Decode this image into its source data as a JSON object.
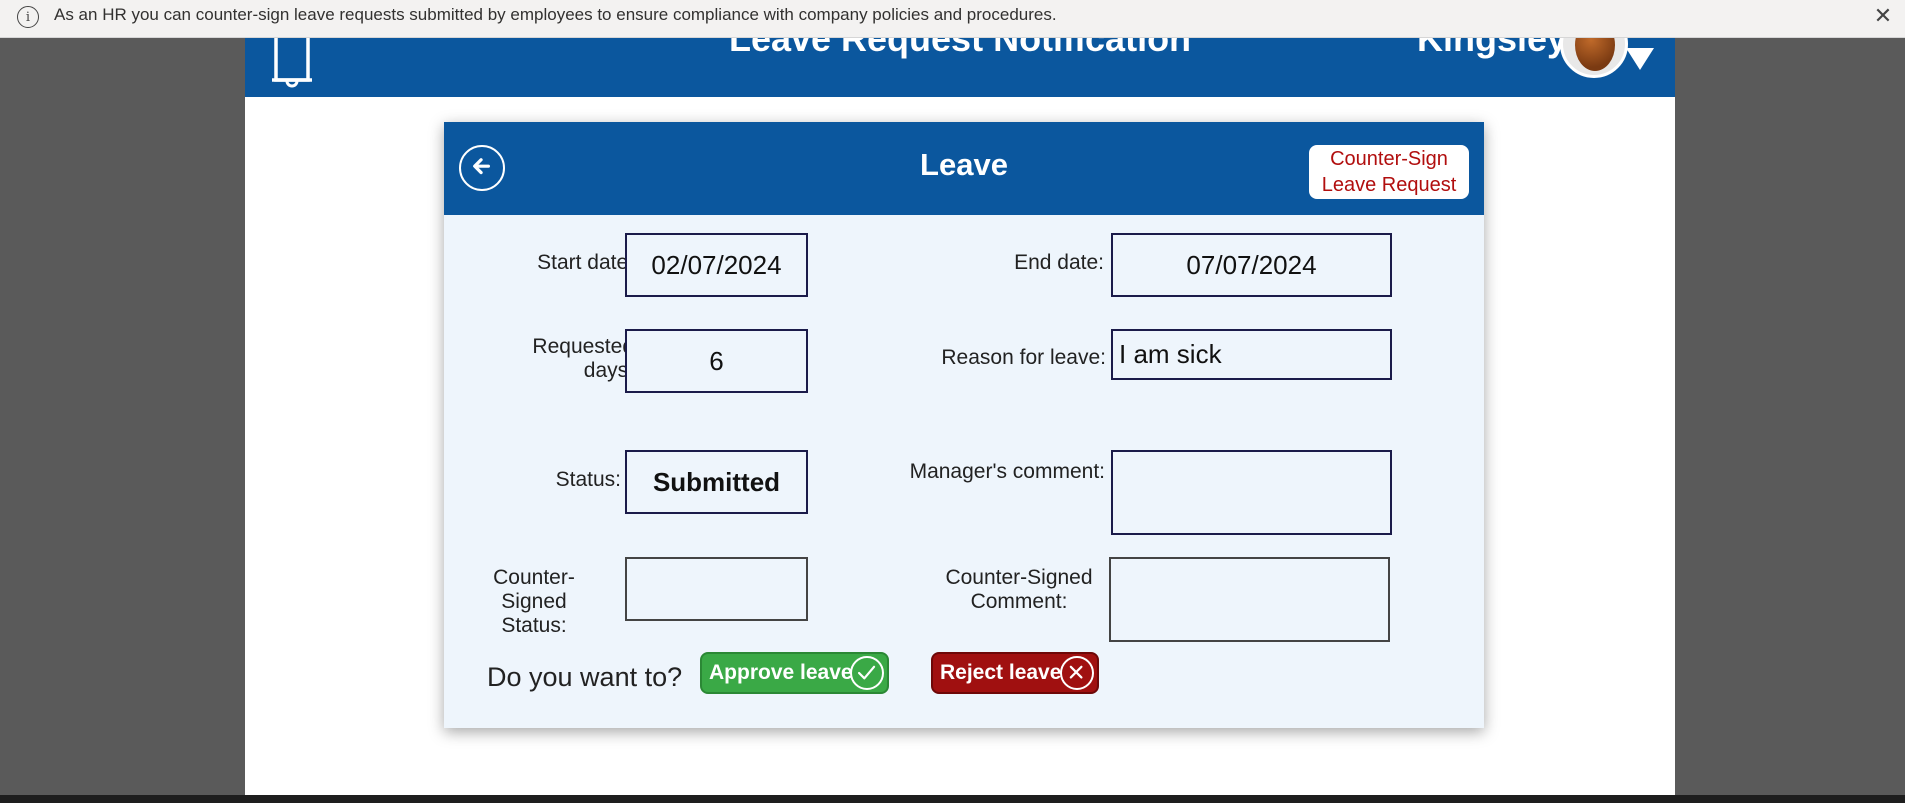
{
  "infobar": {
    "message": "As an HR you can counter-sign leave requests submitted by employees to ensure compliance with company policies and procedures.",
    "info_icon": "info-icon",
    "close_icon": "close-icon",
    "close_glyph": "✕",
    "info_glyph": "i"
  },
  "header": {
    "title": "Leave Request Notification",
    "user_name": "Kingsley",
    "bell_icon": "bell-icon",
    "avatar_icon": "avatar",
    "dropdown_icon": "chevron-down-icon"
  },
  "card": {
    "title": "Leave",
    "back_icon": "back-arrow-icon",
    "countersign_line1": "Counter-Sign",
    "countersign_line2": "Leave Request"
  },
  "form": {
    "start_date_label": "Start date:",
    "start_date_value": "02/07/2024",
    "end_date_label": "End date:",
    "end_date_value": "07/07/2024",
    "requested_days_label_line1": "Requested",
    "requested_days_label_line2": "days:",
    "requested_days_value": "6",
    "reason_label": "Reason for leave:",
    "reason_value": "I am sick",
    "status_label": "Status:",
    "status_value": "Submitted",
    "manager_comment_label": "Manager's comment:",
    "manager_comment_value": "",
    "cs_status_label_line1": "Counter-Signed",
    "cs_status_label_line2": "Status:",
    "cs_status_value": "",
    "cs_comment_label_line1": "Counter-Signed",
    "cs_comment_label_line2": "Comment:",
    "cs_comment_value": ""
  },
  "actions": {
    "prompt": "Do you want to?",
    "approve_label": "Approve leave",
    "approve_icon": "checkmark-icon",
    "reject_label": "Reject leave",
    "reject_icon": "x-circle-icon"
  },
  "colors": {
    "header_blue": "#0b579e",
    "card_bg": "#eef5fc",
    "approve_green": "#3aa946",
    "reject_red": "#a01010",
    "countersign_text": "#b10e0e"
  }
}
